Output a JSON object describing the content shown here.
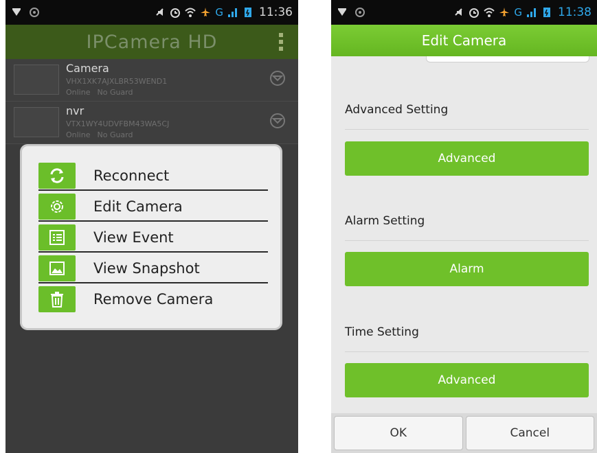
{
  "left": {
    "status": {
      "time": "11:36",
      "network": "G"
    },
    "header": {
      "title": "IPCamera HD"
    },
    "cameras": [
      {
        "name": "Camera",
        "id": "VHX1XK7AJXLBR53WEND1",
        "state": "Online",
        "guard": "No Guard"
      },
      {
        "name": "nvr",
        "id": "VTX1WY4UDVFBM43WA5CJ",
        "state": "Online",
        "guard": "No Guard"
      }
    ],
    "menu": [
      {
        "label": "Reconnect",
        "icon": "refresh-icon"
      },
      {
        "label": "Edit Camera",
        "icon": "gear-icon"
      },
      {
        "label": "View Event",
        "icon": "list-icon"
      },
      {
        "label": "View Snapshot",
        "icon": "image-icon"
      },
      {
        "label": "Remove Camera",
        "icon": "trash-icon"
      }
    ]
  },
  "right": {
    "status": {
      "time": "11:38",
      "network": "G"
    },
    "header": {
      "title": "Edit Camera"
    },
    "sections": [
      {
        "title": "Advanced Setting",
        "button": "Advanced"
      },
      {
        "title": "Alarm Setting",
        "button": "Alarm"
      },
      {
        "title": "Time Setting",
        "button": "Advanced"
      }
    ],
    "footer": {
      "ok": "OK",
      "cancel": "Cancel"
    }
  },
  "colors": {
    "accent": "#6fc02a",
    "header_dim": "#3c5a1a",
    "clock_blue": "#2fa8ea"
  }
}
